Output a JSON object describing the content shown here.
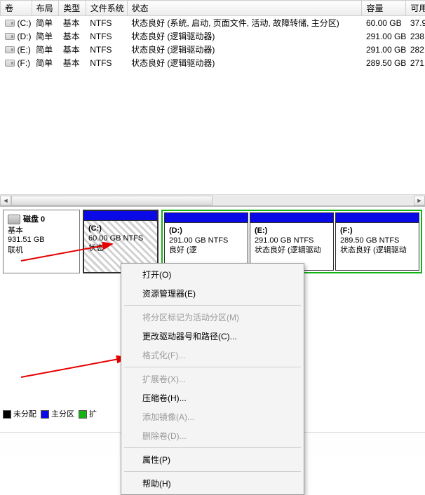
{
  "columns": {
    "volume": "卷",
    "layout": "布局",
    "type": "类型",
    "fs": "文件系统",
    "status": "状态",
    "capacity": "容量",
    "available": "可用"
  },
  "volumes": [
    {
      "letter": "(C:)",
      "layout": "简单",
      "type": "基本",
      "fs": "NTFS",
      "status": "状态良好 (系统, 启动, 页面文件, 活动, 故障转储, 主分区)",
      "capacity": "60.00 GB",
      "available": "37.9"
    },
    {
      "letter": "(D:)",
      "layout": "简单",
      "type": "基本",
      "fs": "NTFS",
      "status": "状态良好 (逻辑驱动器)",
      "capacity": "291.00 GB",
      "available": "238."
    },
    {
      "letter": "(E:)",
      "layout": "简单",
      "type": "基本",
      "fs": "NTFS",
      "status": "状态良好 (逻辑驱动器)",
      "capacity": "291.00 GB",
      "available": "282."
    },
    {
      "letter": "(F:)",
      "layout": "简单",
      "type": "基本",
      "fs": "NTFS",
      "status": "状态良好 (逻辑驱动器)",
      "capacity": "289.50 GB",
      "available": "271."
    }
  ],
  "disk": {
    "name": "磁盘 0",
    "type": "基本",
    "size": "931.51 GB",
    "state": "联机"
  },
  "partitions": {
    "c": {
      "label": "(C:)",
      "size": "60.00 GB NTFS",
      "state": "状态"
    },
    "d": {
      "label": "(D:)",
      "size": "291.00 GB NTFS",
      "state": "良好 (逻"
    },
    "e": {
      "label": "(E:)",
      "size": "291.00 GB NTFS",
      "state": "状态良好 (逻辑驱动"
    },
    "f": {
      "label": "(F:)",
      "size": "289.50 GB NTFS",
      "state": "状态良好 (逻辑驱动"
    }
  },
  "legend": {
    "unalloc": "未分配",
    "primary": "主分区",
    "ext": "扩"
  },
  "menu": {
    "open": "打开(O)",
    "explorer": "资源管理器(E)",
    "markActive": "将分区标记为活动分区(M)",
    "changeLetter": "更改驱动器号和路径(C)...",
    "format": "格式化(F)...",
    "extend": "扩展卷(X)...",
    "shrink": "压缩卷(H)...",
    "mirror": "添加镜像(A)...",
    "delete": "删除卷(D)...",
    "properties": "属性(P)",
    "help": "帮助(H)"
  }
}
